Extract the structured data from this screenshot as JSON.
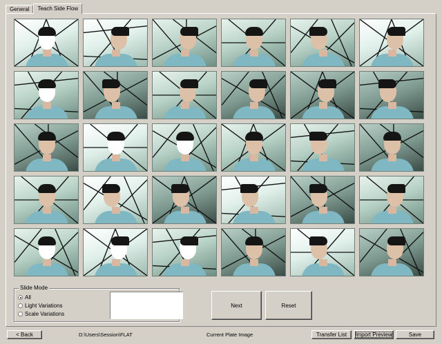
{
  "tabs": [
    "General",
    "Teach Side Flow"
  ],
  "grid": {
    "thumbnails": [
      {
        "variant": "bright glare"
      },
      {
        "variant": "bright side"
      },
      {
        "variant": "side"
      },
      {
        "variant": ""
      },
      {
        "variant": "left"
      },
      {
        "variant": "bright side"
      },
      {
        "variant": "glare"
      },
      {
        "variant": "dark left"
      },
      {
        "variant": "side"
      },
      {
        "variant": "dark side"
      },
      {
        "variant": "dark side"
      },
      {
        "variant": "dark left"
      },
      {
        "variant": "dark"
      },
      {
        "variant": "bright glare"
      },
      {
        "variant": "glare"
      },
      {
        "variant": ""
      },
      {
        "variant": "left"
      },
      {
        "variant": "dark"
      },
      {
        "variant": ""
      },
      {
        "variant": "bright left"
      },
      {
        "variant": "dark left"
      },
      {
        "variant": "bright left"
      },
      {
        "variant": "dark left"
      },
      {
        "variant": "side"
      },
      {
        "variant": "glare"
      },
      {
        "variant": "bright glare side"
      },
      {
        "variant": "glare side"
      },
      {
        "variant": "dark"
      },
      {
        "variant": "bright left"
      },
      {
        "variant": "dark side"
      }
    ]
  },
  "slide_mode": {
    "legend": "Slide Mode",
    "options": [
      "All",
      "Light Variations",
      "Scale Variations"
    ],
    "selected_index": 0
  },
  "buttons": {
    "next": "Next",
    "reset": "Reset",
    "back": "< Back",
    "transfer": "Transfer List",
    "import": "Import Preview",
    "save": "Save"
  },
  "status": {
    "path": "D:\\Users\\Session\\FLAT",
    "mode": "Current Plate Image"
  },
  "colors": {
    "face": "#d4d0c8",
    "shirt": "#7fb7c2",
    "lattice": "#111111"
  }
}
